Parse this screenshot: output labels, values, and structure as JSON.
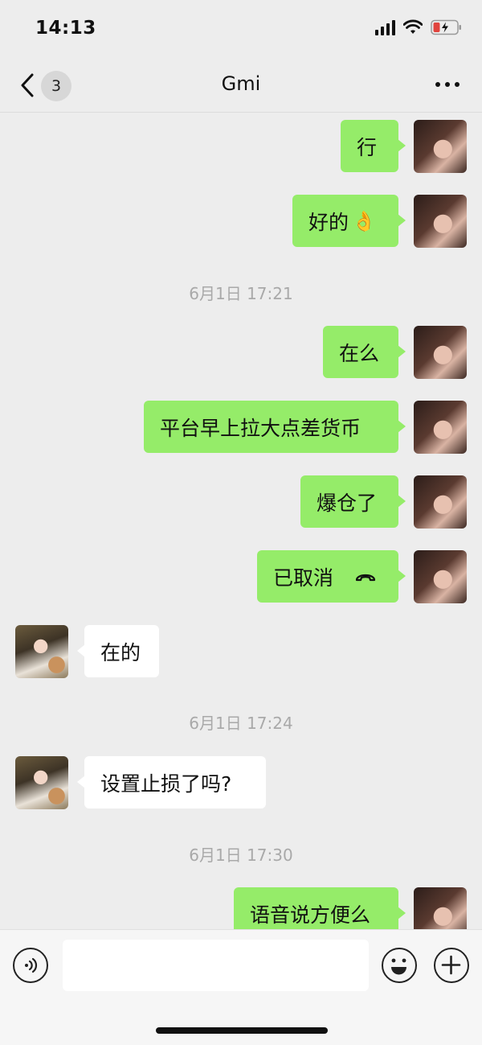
{
  "status_bar": {
    "time": "14:13"
  },
  "header": {
    "unread_count": "3",
    "title": "Gmi"
  },
  "messages": {
    "m1": "行",
    "m2": "好的",
    "m2_emoji": "👌",
    "t1": "6月1日 17:21",
    "m3": "在么",
    "m4": "平台早上拉大点差货币",
    "m5": "爆仓了",
    "m6": "已取消",
    "m7": "在的",
    "t2": "6月1日 17:24",
    "m8": "设置止损了吗?",
    "t3": "6月1日 17:30",
    "m9": "语音说方便么"
  },
  "colors": {
    "outgoing_bubble": "#95ec69",
    "incoming_bubble": "#ffffff",
    "background": "#ededed"
  },
  "icons": [
    "back-icon",
    "more-icon",
    "voice-icon",
    "emoji-icon",
    "plus-icon",
    "hangup-icon"
  ]
}
